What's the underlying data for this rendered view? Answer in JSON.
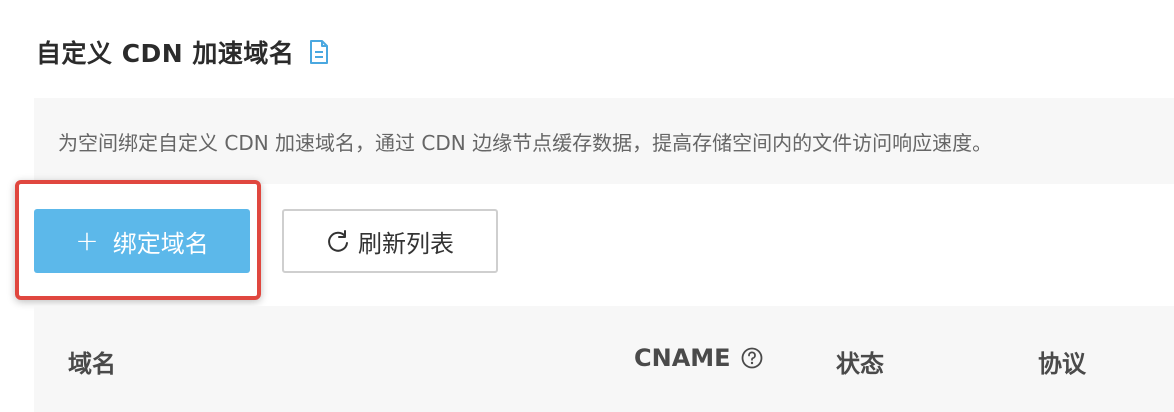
{
  "header": {
    "title": "自定义 CDN 加速域名"
  },
  "description": {
    "text": "为空间绑定自定义 CDN 加速域名，通过 CDN 边缘节点缓存数据，提高存储空间内的文件访问响应速度。"
  },
  "toolbar": {
    "bind_button": {
      "icon": "plus-icon",
      "label": "绑定域名"
    },
    "refresh_button": {
      "icon": "refresh-icon",
      "label": "刷新列表"
    }
  },
  "table": {
    "columns": [
      "域名",
      "CNAME",
      "状态",
      "协议"
    ],
    "cname_help_icon": "question-circle-icon"
  },
  "colors": {
    "primary": "#5cb8ea",
    "highlight": "#e0473f",
    "doc_icon": "#4aa8e0"
  }
}
